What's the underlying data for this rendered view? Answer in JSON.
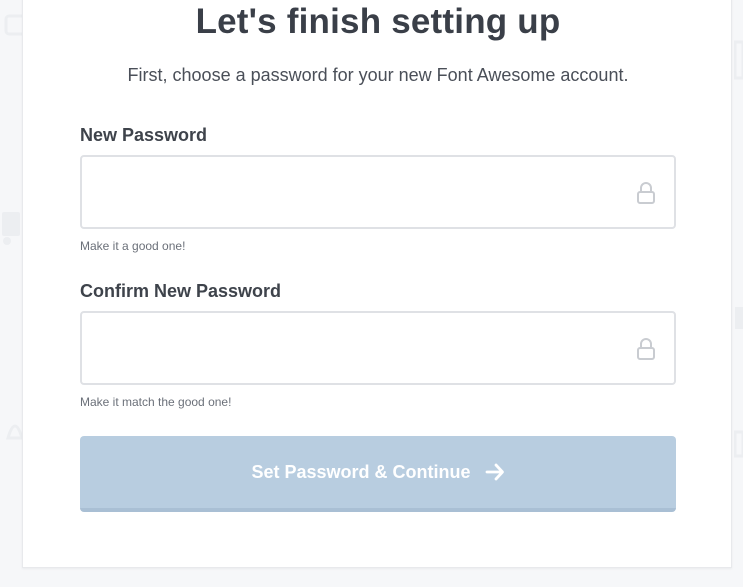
{
  "page": {
    "title": "Let's finish setting up",
    "subtitle": "First, choose a password for your new Font Awesome account."
  },
  "form": {
    "new_password": {
      "label": "New Password",
      "value": "",
      "placeholder": "",
      "hint": "Make it a good one!",
      "icon": "lock-icon"
    },
    "confirm_password": {
      "label": "Confirm New Password",
      "value": "",
      "placeholder": "",
      "hint": "Make it match the good one!",
      "icon": "lock-icon"
    },
    "submit": {
      "label": "Set Password & Continue",
      "icon": "arrow-right-icon",
      "state": "disabled"
    }
  },
  "colors": {
    "background": "#f6f7f9",
    "card": "#ffffff",
    "title_text": "#3a3f48",
    "field_border": "#dfe1e5",
    "button_disabled": "#b8cde0",
    "button_text": "#ffffff",
    "hint_text": "#6b7079"
  }
}
